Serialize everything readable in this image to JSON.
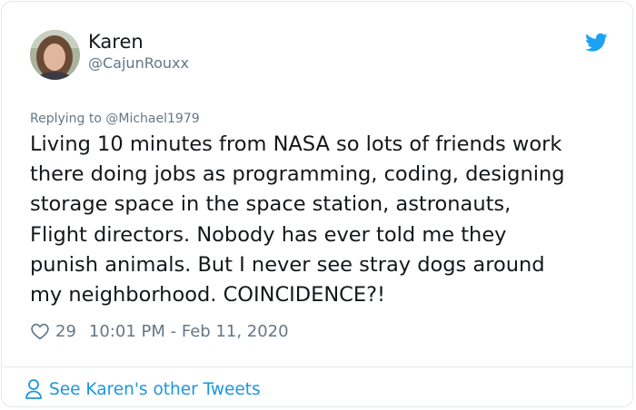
{
  "author": {
    "name": "Karen",
    "handle": "@CajunRouxx",
    "avatar_icon": "avatar"
  },
  "reply": {
    "text": "Replying to @Michael1979"
  },
  "tweet": {
    "text": "Living 10 minutes from NASA so lots of friends work\nthere doing jobs as programming, coding, designing\nstorage space in the space station, astronauts,\nFlight directors. Nobody has ever told me they\npunish animals. But I never see stray dogs around\nmy neighborhood. COINCIDENCE?!",
    "likes": "29",
    "timestamp": "10:01 PM - Feb 11, 2020"
  },
  "footer": {
    "label": "See Karen's other Tweets",
    "icon": "person-icon"
  },
  "colors": {
    "accent": "#1da1f2",
    "link": "#1b95e0",
    "secondary_text": "#657786",
    "border": "#e1e8ed"
  }
}
